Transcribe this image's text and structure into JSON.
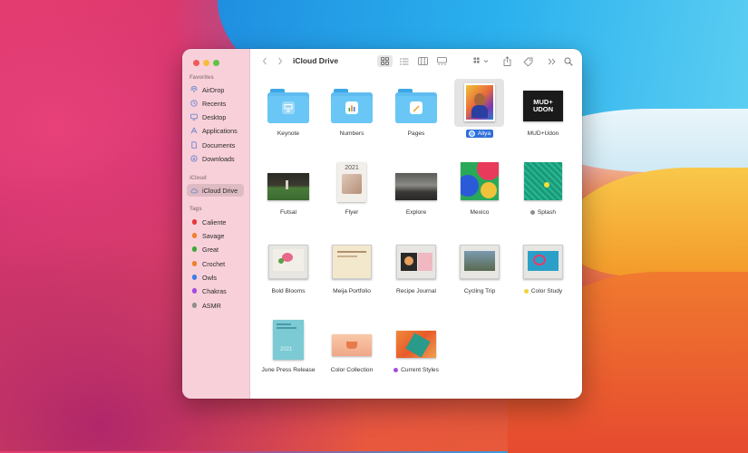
{
  "window": {
    "title": "iCloud Drive"
  },
  "sidebar": {
    "favorites_header": "Favorites",
    "favorites": [
      {
        "label": "AirDrop",
        "icon": "airdrop-icon"
      },
      {
        "label": "Recents",
        "icon": "clock-icon"
      },
      {
        "label": "Desktop",
        "icon": "desktop-icon"
      },
      {
        "label": "Applications",
        "icon": "applications-icon"
      },
      {
        "label": "Documents",
        "icon": "document-icon"
      },
      {
        "label": "Downloads",
        "icon": "download-icon"
      }
    ],
    "icloud_header": "iCloud",
    "icloud": [
      {
        "label": "iCloud Drive",
        "icon": "cloud-icon",
        "selected": true
      }
    ],
    "tags_header": "Tags",
    "tags": [
      {
        "label": "Caliente",
        "color": "#e8363c"
      },
      {
        "label": "Savage",
        "color": "#f0802c"
      },
      {
        "label": "Great",
        "color": "#3aaa35"
      },
      {
        "label": "Crochet",
        "color": "#f0802c"
      },
      {
        "label": "Owls",
        "color": "#3a7ee8"
      },
      {
        "label": "Chakras",
        "color": "#a24be0"
      },
      {
        "label": "ASMR",
        "color": "#8e8e8e"
      }
    ]
  },
  "files": [
    {
      "name": "Keynote",
      "kind": "folder"
    },
    {
      "name": "Numbers",
      "kind": "folder"
    },
    {
      "name": "Pages",
      "kind": "folder"
    },
    {
      "name": "Aliya",
      "kind": "image",
      "selected": true,
      "tag_color": "#3a7ee8"
    },
    {
      "name": "MUD+Udon",
      "kind": "image",
      "text": "MUD+ UDON"
    },
    {
      "name": "Futsal",
      "kind": "image"
    },
    {
      "name": "Flyer",
      "kind": "document",
      "text": "2021"
    },
    {
      "name": "Explore",
      "kind": "image"
    },
    {
      "name": "Mexico",
      "kind": "image"
    },
    {
      "name": "Splash",
      "kind": "image",
      "tag_color": "#8e8e8e"
    },
    {
      "name": "Bold Blooms",
      "kind": "keynote"
    },
    {
      "name": "Meija Portfolio",
      "kind": "keynote"
    },
    {
      "name": "Recipe Journal",
      "kind": "keynote"
    },
    {
      "name": "Cycling Trip",
      "kind": "keynote"
    },
    {
      "name": "Color Study",
      "kind": "keynote",
      "tag_color": "#f2d23a"
    },
    {
      "name": "June Press Release",
      "kind": "document",
      "text": "2021"
    },
    {
      "name": "Color Collection",
      "kind": "image"
    },
    {
      "name": "Current Styles",
      "kind": "image",
      "tag_color": "#a24be0"
    }
  ]
}
